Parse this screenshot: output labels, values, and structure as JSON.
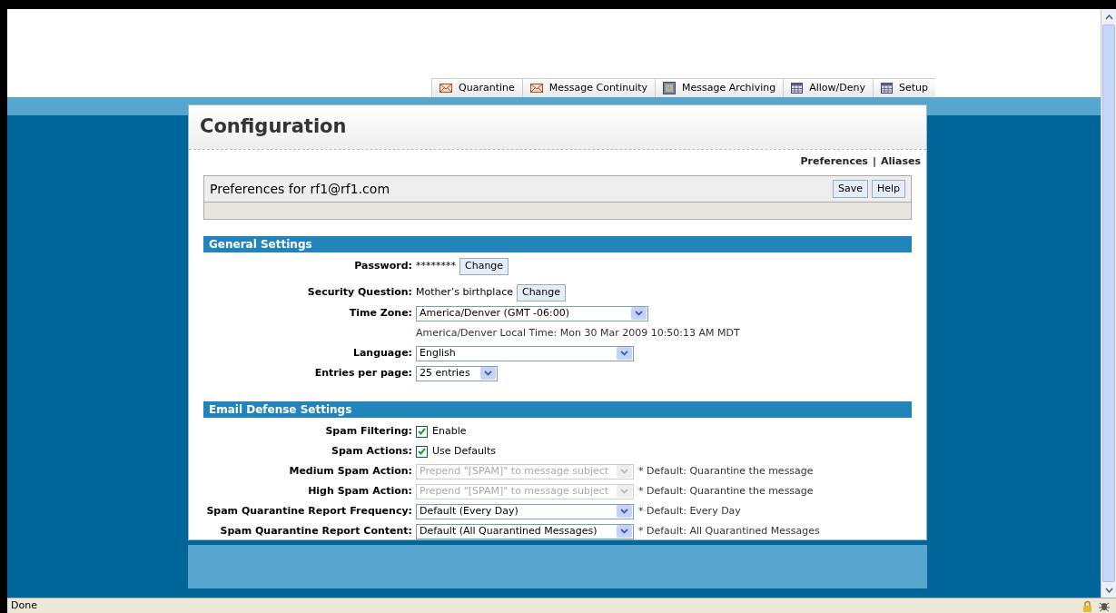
{
  "tabs": [
    {
      "label": "Quarantine",
      "kind": "envelope"
    },
    {
      "label": "Message Continuity",
      "kind": "envelope"
    },
    {
      "label": "Message Archiving",
      "kind": "safe"
    },
    {
      "label": "Allow/Deny",
      "kind": "calendar"
    },
    {
      "label": "Setup",
      "kind": "calendar"
    }
  ],
  "page_title": "Configuration",
  "sub_links": [
    "Preferences",
    "Aliases"
  ],
  "link_separator": "|",
  "preferences_header": {
    "title": "Preferences for rf1@rf1.com",
    "buttons": [
      "Save",
      "Help"
    ]
  },
  "sections": [
    {
      "title": "General Settings",
      "rows": [
        {
          "kind": "text_button",
          "label": "Password:",
          "value": "********",
          "button": "Change"
        },
        {
          "kind": "text_button",
          "label": "Security Question:",
          "value": "Mother’s birthplace",
          "button": "Change"
        },
        {
          "kind": "select",
          "label": "Time Zone:",
          "value": "America/Denver (GMT -06:00)",
          "disabled": false
        },
        {
          "kind": "note",
          "value": "America/Denver Local Time: Mon 30 Mar 2009 10:50:13 AM MDT"
        },
        {
          "kind": "select",
          "label": "Language:",
          "value": "English",
          "disabled": false
        },
        {
          "kind": "small_select",
          "label": "Entries per page:",
          "value": "25 entries",
          "disabled": false
        }
      ]
    },
    {
      "title": "Email Defense Settings",
      "rows": [
        {
          "kind": "checkbox",
          "label": "Spam Filtering:",
          "value": "Enable",
          "checked": true
        },
        {
          "kind": "checkbox",
          "label": "Spam Actions:",
          "value": "Use Defaults",
          "checked": true
        },
        {
          "kind": "select",
          "label": "Medium Spam Action:",
          "value": "Prepend \"[SPAM]\" to message subject",
          "disabled": true,
          "hint": "* Default: Quarantine the message"
        },
        {
          "kind": "select",
          "label": "High Spam Action:",
          "value": "Prepend \"[SPAM]\" to message subject",
          "disabled": true,
          "hint": "* Default: Quarantine the message"
        },
        {
          "kind": "select",
          "label": "Spam Quarantine Report Frequency:",
          "value": "Default (Every Day)",
          "disabled": false,
          "hint": "* Default: Every Day"
        },
        {
          "kind": "select",
          "label": "Spam Quarantine Report Content:",
          "value": "Default (All Quarantined Messages)",
          "disabled": false,
          "hint": "* Default: All Quarantined Messages"
        }
      ]
    }
  ],
  "status_bar": {
    "text": "Done"
  }
}
